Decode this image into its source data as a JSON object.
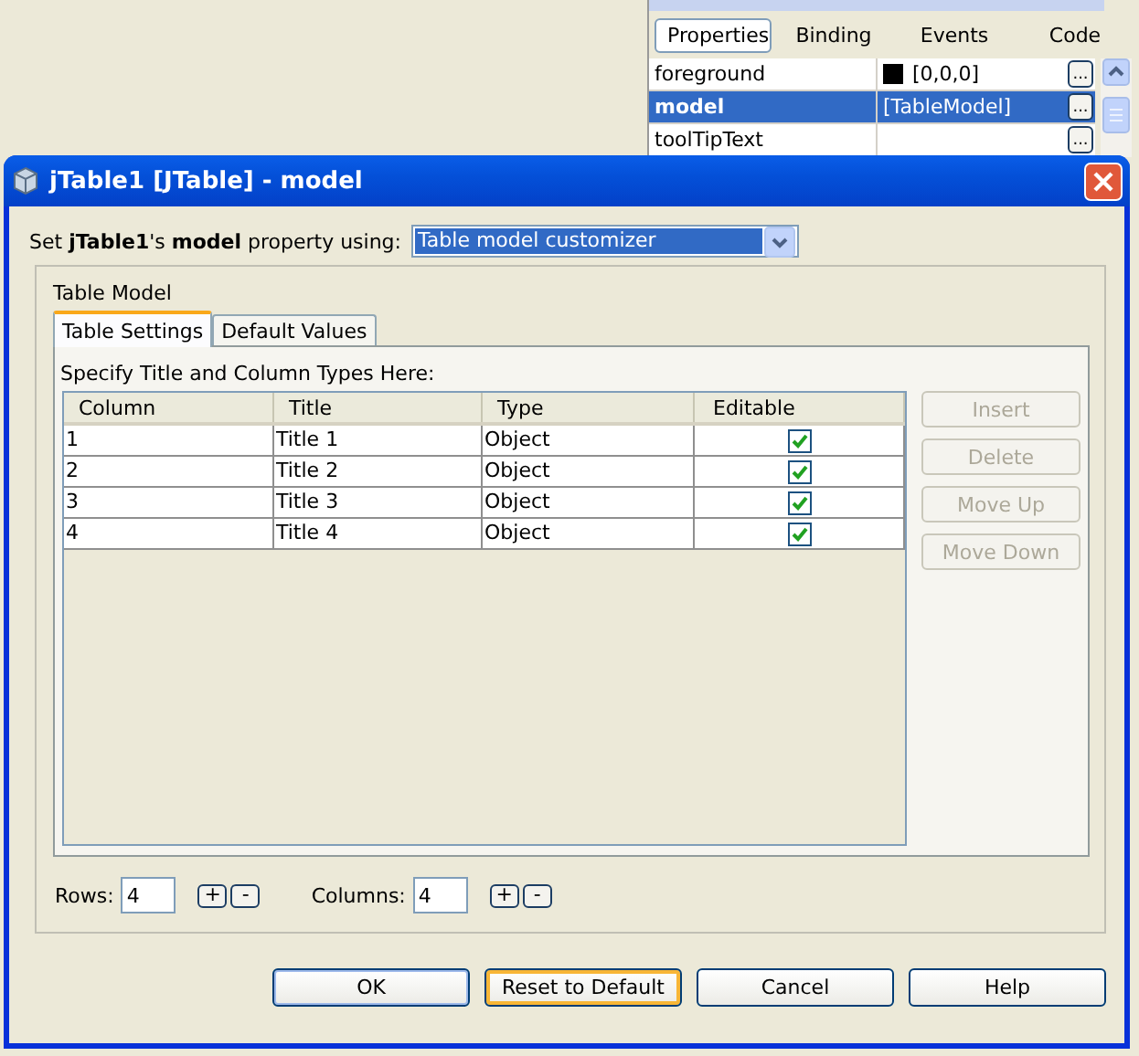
{
  "properties_panel": {
    "tabs": [
      {
        "label": "Properties",
        "selected": true
      },
      {
        "label": "Binding",
        "selected": false
      },
      {
        "label": "Events",
        "selected": false
      },
      {
        "label": "Code",
        "selected": false
      }
    ],
    "rows": [
      {
        "name": "foreground",
        "value": "[0,0,0]",
        "color": "#000000",
        "button": "...",
        "selected": false
      },
      {
        "name": "model",
        "value": "[TableModel]",
        "button": "...",
        "selected": true
      },
      {
        "name": "toolTipText",
        "button": "...",
        "selected": false
      }
    ]
  },
  "dialog": {
    "title": "jTable1 [JTable] - model",
    "source_label": "Set **jTable1**'s **model** property using:",
    "source_select": "Table model customizer",
    "group_title": "Table Model",
    "tabs": [
      {
        "label": "Table Settings",
        "selected": true
      },
      {
        "label": "Default Values",
        "selected": false
      }
    ],
    "instruction": "Specify Title and Column Types Here:",
    "table": {
      "columns": [
        "Column",
        "Title",
        "Type",
        "Editable"
      ],
      "rows": [
        {
          "cells": [
            "1",
            "Title 1",
            "Object"
          ],
          "editable": true
        },
        {
          "cells": [
            "2",
            "Title 2",
            "Object"
          ],
          "editable": true
        },
        {
          "cells": [
            "3",
            "Title 3",
            "Object"
          ],
          "editable": true
        },
        {
          "cells": [
            "4",
            "Title 4",
            "Object"
          ],
          "editable": true
        }
      ]
    },
    "side_buttons": [
      {
        "label": "Insert",
        "disabled": true
      },
      {
        "label": "Delete",
        "disabled": true
      },
      {
        "label": "Move Up",
        "disabled": true
      },
      {
        "label": "Move Down",
        "disabled": true
      }
    ],
    "counters": [
      {
        "label": "Rows:",
        "value": "4",
        "plus": "+",
        "minus": "-"
      },
      {
        "label": "Columns:",
        "value": "4",
        "plus": "+",
        "minus": "-"
      }
    ],
    "buttons": [
      {
        "label": "OK",
        "default": true,
        "focused": false
      },
      {
        "label": "Reset to Default",
        "default": false,
        "focused": true
      },
      {
        "label": "Cancel",
        "default": false,
        "focused": false
      },
      {
        "label": "Help",
        "default": false,
        "focused": false
      }
    ]
  }
}
